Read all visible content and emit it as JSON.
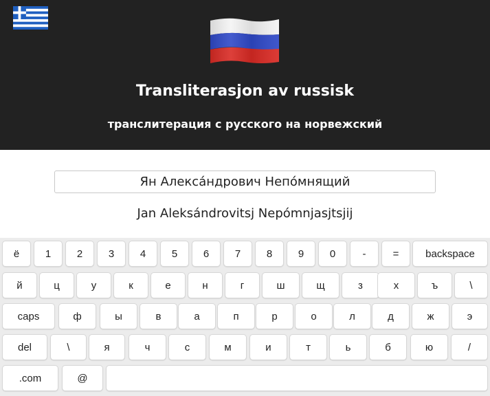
{
  "header": {
    "title": "Transliterasjon av russisk",
    "subtitle": "транслитерация с русского на норвежский",
    "colors": {
      "background": "#222222",
      "text": "#ffffff"
    },
    "icons": [
      "greek-flag-icon",
      "russian-flag-icon"
    ]
  },
  "input": {
    "value": "Ян Алекса́ндрович Непо́мнящий"
  },
  "output": {
    "text": "Jan Aleksándrovitsj Nepómnjasjtsjij"
  },
  "keyboard": {
    "rows": [
      [
        "ё",
        "1",
        "2",
        "3",
        "4",
        "5",
        "6",
        "7",
        "8",
        "9",
        "0",
        "-",
        "=",
        "backspace"
      ],
      [
        "й",
        "ц",
        "у",
        "к",
        "е",
        "н",
        "г",
        "ш",
        "щ",
        "з",
        "х",
        "ъ",
        "\\"
      ],
      [
        "caps",
        "ф",
        "ы",
        "в",
        "а",
        "п",
        "р",
        "о",
        "л",
        "д",
        "ж",
        "э"
      ],
      [
        "del",
        "\\",
        "я",
        "ч",
        "с",
        "м",
        "и",
        "т",
        "ь",
        "б",
        "ю",
        "/"
      ],
      [
        ".com",
        "@",
        ""
      ]
    ]
  }
}
